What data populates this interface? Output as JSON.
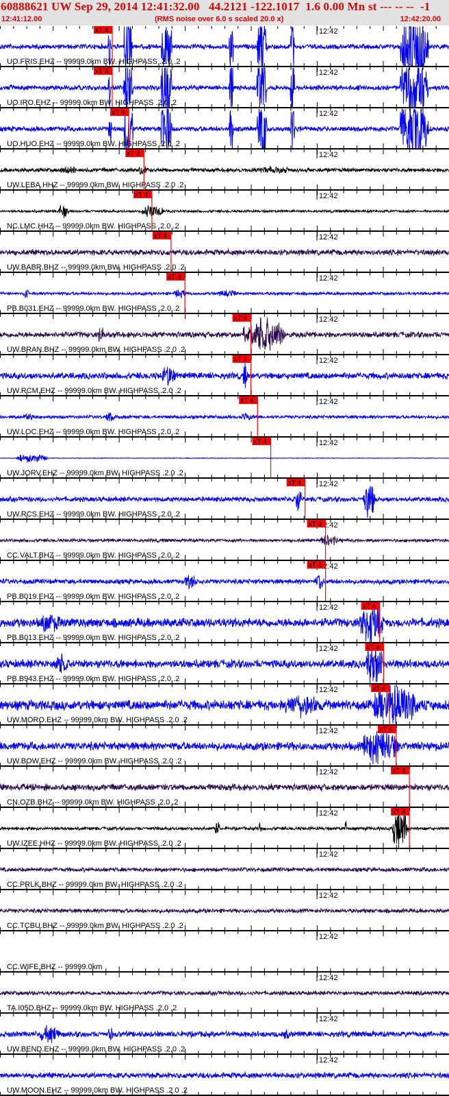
{
  "header": {
    "title": "60888621 UW Sep 29, 2014 12:41:32.00   44.2121 -122.1017  1.6 0.00 Mn st --- -- --  -1",
    "start_time": "12:41:12.00",
    "note": "(RMS noise over 6.0 s scaled 20.0 x)",
    "end_time": "12:42:20.00"
  },
  "axis": {
    "duration_s": 68,
    "minute_label": "12:42",
    "minute_offset_s": 48,
    "major_tick_s": 10,
    "minor_tick_s": 2
  },
  "pick_label": "xT 4",
  "colors": {
    "blue": "#0000ff",
    "purple": "#2a0a4e",
    "black": "#000000",
    "pick": "#ff0000",
    "header_bg": "#e2e2e2"
  },
  "traces": [
    {
      "label": "UO.FRIS.EHZ -- 99999.0km BW. HIGHPASS .2.0 .2",
      "color": "blue",
      "noise": 3,
      "pick_s": 17.0,
      "bursts": [
        [
          16.4,
          17.0,
          40
        ],
        [
          18.7,
          21.2,
          60
        ],
        [
          24.4,
          27.2,
          60
        ],
        [
          34.7,
          35.8,
          60
        ],
        [
          38.9,
          41.5,
          60
        ],
        [
          44.0,
          45.0,
          60
        ],
        [
          60.6,
          68,
          60
        ]
      ]
    },
    {
      "label": "UO.IRO.EHZ -- 99999.0km BW. HIGHPASS .2.0 .2",
      "color": "blue",
      "noise": 3,
      "pick_s": 17.0,
      "bursts": [
        [
          16.4,
          17.0,
          40
        ],
        [
          18.7,
          21.2,
          60
        ],
        [
          24.4,
          27.2,
          60
        ],
        [
          34.7,
          35.8,
          60
        ],
        [
          38.9,
          41.5,
          60
        ],
        [
          44.0,
          45.0,
          60
        ],
        [
          60.6,
          68,
          60
        ]
      ]
    },
    {
      "label": "UO.HUO.EHZ -- 99999.0km BW. HIGHPASS .2.0 .2",
      "color": "blue",
      "noise": 3,
      "pick_s": 19.5,
      "bursts": [
        [
          16.4,
          17.2,
          40
        ],
        [
          18.7,
          21.2,
          60
        ],
        [
          24.4,
          27.2,
          60
        ],
        [
          34.7,
          35.8,
          60
        ],
        [
          38.9,
          41.5,
          60
        ],
        [
          44.0,
          45.0,
          60
        ],
        [
          60.6,
          68,
          60
        ]
      ]
    },
    {
      "label": "UW.LEBA.HHZ -- 99999.0km BW. HIGHPASS .2.0 .2",
      "color": "black",
      "noise": 2.5,
      "pick_s": 21.8,
      "bursts": [
        [
          9,
          13.5,
          4
        ],
        [
          21,
          23.5,
          8
        ],
        [
          39,
          47,
          3
        ]
      ]
    },
    {
      "label": "NC.LMC.HHZ -- 99999.0km BW. HIGHPASS .2.0 .2",
      "color": "black",
      "noise": 1.5,
      "pick_s": 23.0,
      "bursts": [
        [
          8.8,
          11.5,
          9
        ],
        [
          21.5,
          27,
          10
        ]
      ]
    },
    {
      "label": "UW.BABR.BHZ -- 99999.0km BW. HIGHPASS .2.0 .2",
      "color": "purple",
      "noise": 3.5,
      "pick_s": 25.9,
      "bursts": []
    },
    {
      "label": "PB.B031.EHZ -- 99999.0km BW. HIGHPASS .2.0 .2",
      "color": "blue",
      "noise": 1.8,
      "pick_s": 28.0,
      "bursts": [
        [
          3.5,
          5,
          6
        ],
        [
          26.3,
          29.5,
          5
        ],
        [
          33,
          38.5,
          3
        ]
      ]
    },
    {
      "label": "UW.BRAN.BHZ -- 99999.0km BW. HIGHPASS .2.0 .2",
      "color": "purple",
      "noise": 3.5,
      "pick_s": 38.0,
      "bursts": [
        [
          14.8,
          16.5,
          12
        ],
        [
          36.8,
          47.5,
          28
        ]
      ]
    },
    {
      "label": "UW.RCM.EHZ -- 99999.0km BW. HIGHPASS .2.0 .2",
      "color": "blue",
      "noise": 4,
      "pick_s": 38.0,
      "bursts": [
        [
          24.5,
          28,
          14
        ],
        [
          36.8,
          38,
          18
        ]
      ]
    },
    {
      "label": "UW.LOC.EHZ -- 99999.0km BW. HIGHPASS .2.0 .2",
      "color": "blue",
      "noise": 2,
      "pick_s": 39.0,
      "bursts": [
        [
          3.5,
          6,
          7
        ],
        [
          16,
          18.8,
          6
        ],
        [
          36.5,
          39.5,
          5
        ]
      ]
    },
    {
      "label": "UW.JORV.EHZ -- 99999.0km BW. HIGHPASS .2.0 .2",
      "color": "blue",
      "noise": 0.4,
      "pick_s": 41.0,
      "bursts": [
        [
          2.5,
          10.5,
          7
        ]
      ]
    },
    {
      "label": "UW.RCS.EHZ -- 99999.0km BW. HIGHPASS .2.0 .2",
      "color": "blue",
      "noise": 3,
      "pick_s": 46.2,
      "bursts": [
        [
          44.5,
          46.6,
          16
        ],
        [
          55,
          58,
          30
        ]
      ]
    },
    {
      "label": "CC.VALT.BHZ -- 99999.0km BW. HIGHPASS .2.0 .2",
      "color": "purple",
      "noise": 2,
      "pick_s": 49.3,
      "bursts": [
        [
          48.5,
          53,
          8
        ]
      ]
    },
    {
      "label": "PB.B019.EHZ -- 99999.0km BW. HIGHPASS .2.0 .2",
      "color": "blue",
      "noise": 3,
      "pick_s": 49.3,
      "bursts": [
        [
          28,
          31,
          10
        ],
        [
          47.7,
          50,
          12
        ]
      ]
    },
    {
      "label": "PB.B013.EHZ -- 99999.0km BW. HIGHPASS .2.0 .2",
      "color": "blue",
      "noise": 5.5,
      "pick_s": 57.5,
      "bursts": [
        [
          6.2,
          11.5,
          12
        ],
        [
          54.5,
          60.5,
          30
        ]
      ]
    },
    {
      "label": "PB.B943.EHZ -- 99999.0km BW. HIGHPASS .2.0 .2",
      "color": "blue",
      "noise": 5,
      "pick_s": 58.1,
      "bursts": [
        [
          8.3,
          11.5,
          13
        ],
        [
          55.5,
          60,
          30
        ]
      ]
    },
    {
      "label": "UW.MORO.EHZ -- 99999.0km BW. HIGHPASS .2.0 .2",
      "color": "blue",
      "noise": 6,
      "pick_s": 59.0,
      "bursts": [
        [
          43,
          52,
          12
        ],
        [
          56.5,
          68,
          32
        ]
      ]
    },
    {
      "label": "UW.BOW.EHZ -- 99999.0km BW. HIGHPASS .2.0 .2",
      "color": "blue",
      "noise": 5,
      "pick_s": 60.0,
      "bursts": [
        [
          55,
          64,
          26
        ]
      ]
    },
    {
      "label": "CN.OZB.BHZ -- 99999.0km BW. HIGHPASS .2.0 .2",
      "color": "purple",
      "noise": 4,
      "pick_s": 62.0,
      "bursts": []
    },
    {
      "label": "UW.IZEE.HHZ -- 99999.0km BW. HIGHPASS .2.0 .2",
      "color": "black",
      "noise": 2,
      "pick_s": 62.0,
      "bursts": [
        [
          32.5,
          33.8,
          12
        ],
        [
          39.2,
          39.8,
          12
        ],
        [
          52.2,
          52.7,
          10
        ],
        [
          59.5,
          63.5,
          32
        ]
      ]
    },
    {
      "label": "CC.PRLK.BHZ -- 99999.0km BW. HIGHPASS .2.0 .2",
      "color": "purple",
      "noise": 2.5,
      "pick_s": null,
      "bursts": []
    },
    {
      "label": "CC.TCBU.BHZ -- 99999.0km BW. HIGHPASS .2.0 .2",
      "color": "purple",
      "noise": 2.5,
      "pick_s": null,
      "bursts": []
    },
    {
      "label": "CC.WIFE.BHZ -- 99999.0km",
      "color": "purple",
      "noise": 0,
      "pick_s": null,
      "bursts": []
    },
    {
      "label": "TA.I05D.BHZ -- 99999.0km BW. HIGHPASS .2.0 .2",
      "color": "purple",
      "noise": 2.5,
      "pick_s": null,
      "bursts": []
    },
    {
      "label": "UW.BEND.EHZ -- 99999.0km BW. HIGHPASS .2.0 .2",
      "color": "blue",
      "noise": 3.5,
      "pick_s": null,
      "bursts": [
        [
          6,
          11,
          10
        ],
        [
          16.3,
          17.6,
          8
        ],
        [
          43,
          44.5,
          6
        ]
      ]
    },
    {
      "label": "UW.MOON.EHZ -- 99999.0km BW. HIGHPASS .2.0 .2",
      "color": "blue",
      "noise": 3.5,
      "pick_s": null,
      "bursts": []
    }
  ]
}
